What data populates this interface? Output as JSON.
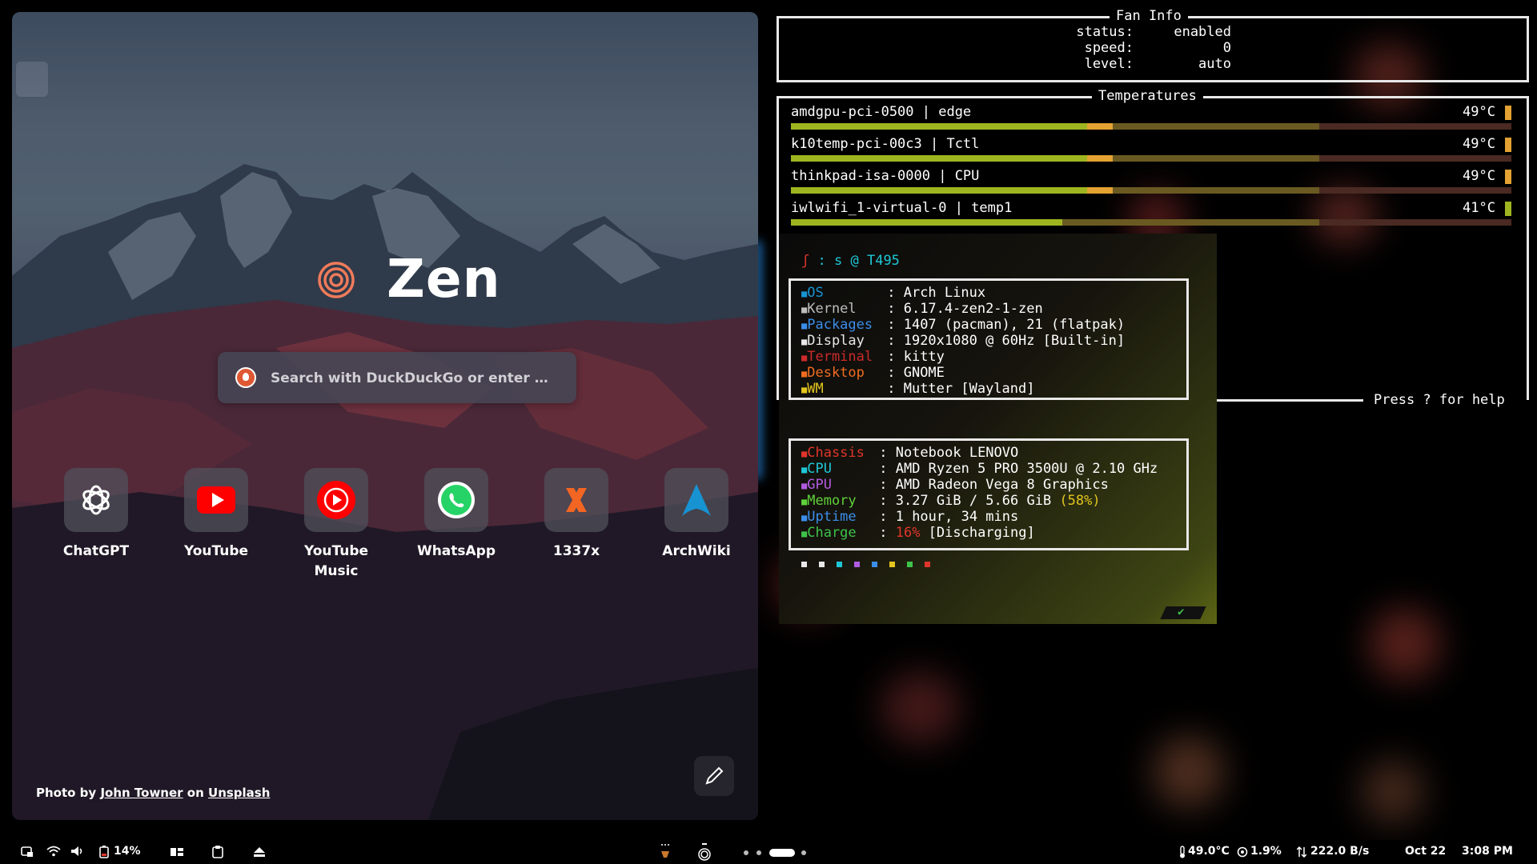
{
  "browser": {
    "brand": "Zen",
    "search_placeholder": "Search with DuckDuckGo or enter …",
    "shortcuts": [
      {
        "label": "ChatGPT",
        "icon": "openai-icon"
      },
      {
        "label": "YouTube",
        "icon": "youtube-icon"
      },
      {
        "label": "YouTube\nMusic",
        "icon": "youtube-music-icon"
      },
      {
        "label": "WhatsApp",
        "icon": "whatsapp-icon"
      },
      {
        "label": "1337x",
        "icon": "x-icon"
      },
      {
        "label": "ArchWiki",
        "icon": "arch-icon"
      }
    ],
    "credit": {
      "prefix": "Photo by",
      "author": "John Towner",
      "mid": "on",
      "site": "Unsplash"
    }
  },
  "fan_info": {
    "title": "Fan Info",
    "rows": [
      {
        "key": "status:",
        "value": "enabled"
      },
      {
        "key": "speed:",
        "value": "0"
      },
      {
        "key": "level:",
        "value": "auto"
      }
    ]
  },
  "temperatures": {
    "title": "Temperatures",
    "sensors": [
      {
        "name": "amdgpu-pci-0500 | edge",
        "value": "49°C",
        "level": 0.49,
        "marker": "#e3a231"
      },
      {
        "name": "k10temp-pci-00c3 | Tctl",
        "value": "49°C",
        "level": 0.49,
        "marker": "#e3a231"
      },
      {
        "name": "thinkpad-isa-0000 | CPU",
        "value": "49°C",
        "level": 0.49,
        "marker": "#e3a231"
      },
      {
        "name": "iwlwifi_1-virtual-0 | temp1",
        "value": "41°C",
        "level": 0.41,
        "marker": "#9fb520"
      }
    ],
    "help": "Press ? for help"
  },
  "fastfetch": {
    "prompt_user": "s",
    "prompt_at": "@",
    "prompt_host": "T495",
    "group1": [
      {
        "key": "OS",
        "value": "Arch Linux",
        "color": "#1793d1",
        "icon": "arch-icon"
      },
      {
        "key": "Kernel",
        "value": "6.17.4-zen2-1-zen",
        "color": "#bdbdbd",
        "icon": "linux-icon"
      },
      {
        "key": "Packages",
        "value": "1407 (pacman), 21 (flatpak)",
        "color": "#3b8eea",
        "icon": "package-icon"
      },
      {
        "key": "Display",
        "value": "1920x1080 @ 60Hz [Built-in]",
        "color": "#e8e8e8",
        "icon": "monitor-icon"
      },
      {
        "key": "Terminal",
        "value": "kitty",
        "color": "#cc2b2b",
        "icon": "terminal-icon"
      },
      {
        "key": "Desktop",
        "value": "GNOME",
        "color": "#f06c1f",
        "icon": "gnome-icon"
      },
      {
        "key": "WM",
        "value": "Mutter [Wayland]",
        "color": "#e3c51f",
        "icon": "window-icon"
      }
    ],
    "group2": [
      {
        "key": "Chassis",
        "value": "Notebook LENOVO",
        "color": "#e0352b",
        "icon": "laptop-icon"
      },
      {
        "key": "CPU",
        "value": "AMD Ryzen 5 PRO 3500U @ 2.10 GHz",
        "color": "#1fc7d6",
        "icon": "cpu-icon"
      },
      {
        "key": "GPU",
        "value": "AMD Radeon Vega 8 Graphics",
        "color": "#b15be0",
        "icon": "gpu-icon"
      },
      {
        "key": "Memory",
        "value": "3.27 GiB / 5.66 GiB",
        "extra": "(58%)",
        "color": "#5fd13a",
        "icon": "memory-icon"
      },
      {
        "key": "Uptime",
        "value": "1 hour, 34 mins",
        "color": "#3b8eea",
        "icon": "clock-icon"
      },
      {
        "key": "Charge",
        "value": "[Discharging]",
        "extra": "16%",
        "color": "#3ec34a",
        "icon": "battery-icon"
      }
    ],
    "palette": [
      "#e8e8e8",
      "#e8e8e8",
      "#1fc7d6",
      "#b15be0",
      "#3b8eea",
      "#e3c51f",
      "#3ec34a",
      "#e0352b"
    ],
    "status_mark": "✔"
  },
  "taskbar": {
    "battery": "14%",
    "temperature": "49.0°C",
    "cpu": "1.9%",
    "network": "222.0 B/s",
    "date": "Oct 22",
    "time": "3:08 PM"
  }
}
